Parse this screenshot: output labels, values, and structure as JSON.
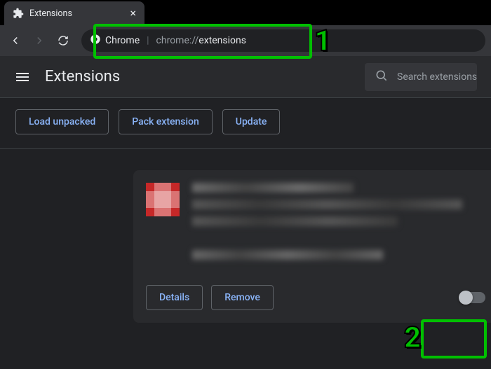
{
  "tab": {
    "title": "Extensions"
  },
  "omnibox": {
    "origin_label": "Chrome",
    "url_scheme": "chrome://",
    "url_path": "extensions"
  },
  "page": {
    "title": "Extensions",
    "search_placeholder": "Search extensions"
  },
  "actions": {
    "load_unpacked": "Load unpacked",
    "pack_extension": "Pack extension",
    "update": "Update"
  },
  "card": {
    "details": "Details",
    "remove": "Remove",
    "enabled": false
  },
  "annotations": {
    "one": "1",
    "two": "2"
  },
  "colors": {
    "accent_blue": "#8ab4f8",
    "annotation_green": "#00c000"
  }
}
